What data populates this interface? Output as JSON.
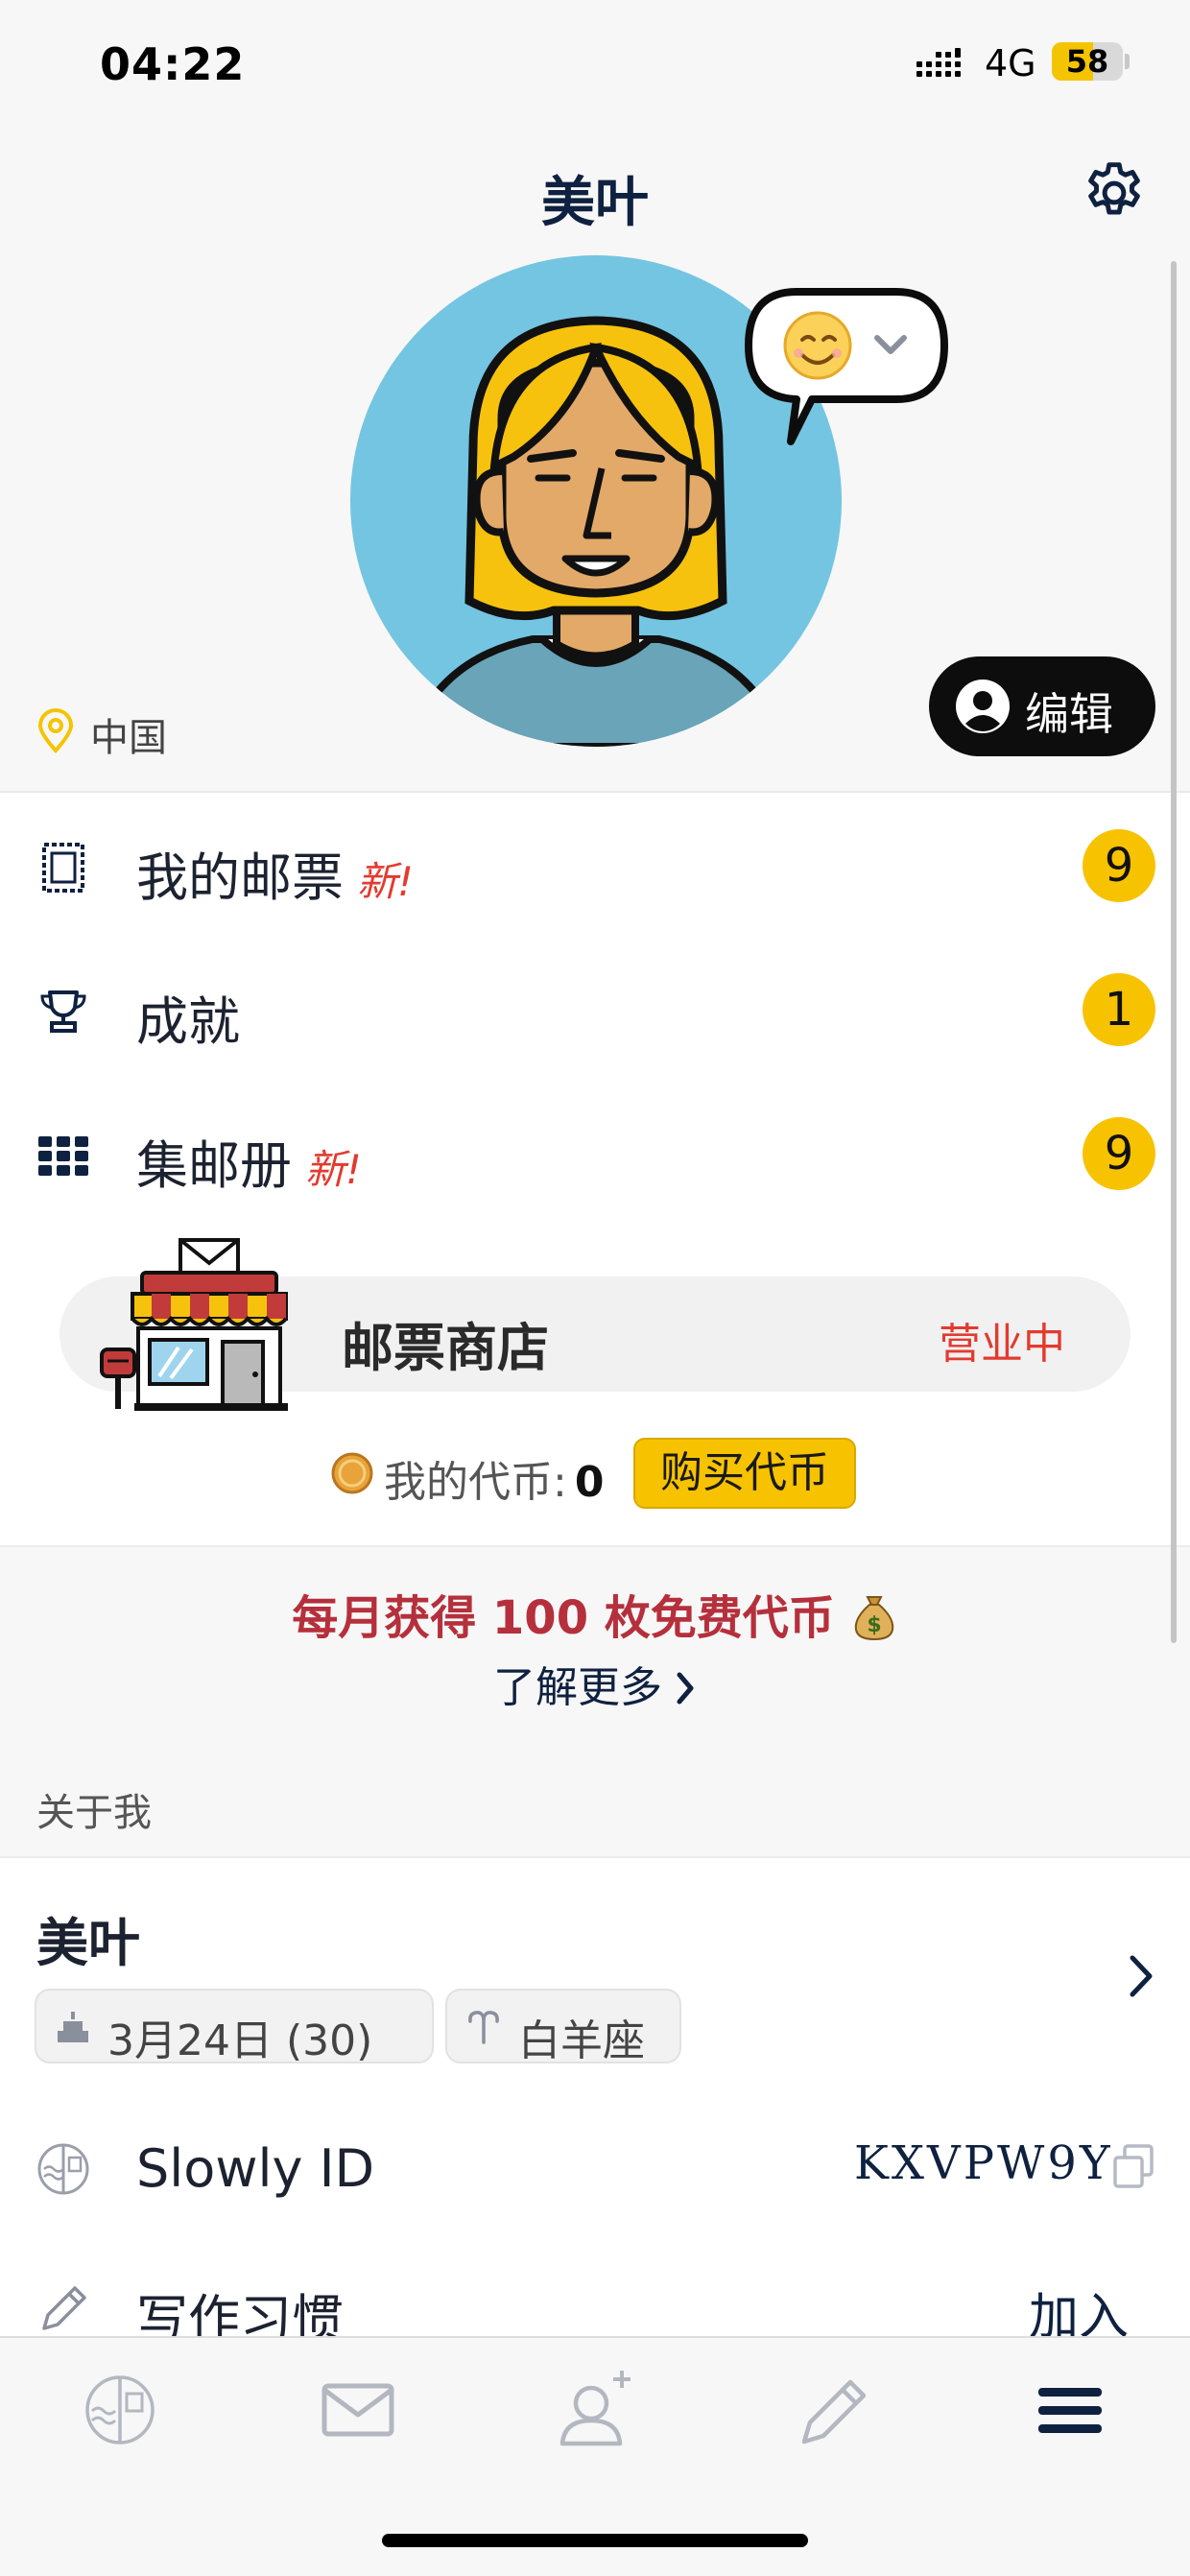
{
  "status_bar": {
    "time": "04:22",
    "network": "4G",
    "battery": "58",
    "battery_level_percent": 58,
    "battery_color": "#f5c400"
  },
  "header": {
    "title": "美叶",
    "settings_icon": "gear-icon"
  },
  "profile": {
    "mood_emoji": "😊",
    "location": "中国",
    "edit_label": "编辑"
  },
  "menu": [
    {
      "label": "我的邮票",
      "new": "新!",
      "count": "9",
      "icon": "stamp-icon"
    },
    {
      "label": "成就",
      "new": "",
      "count": "1",
      "icon": "trophy-icon"
    },
    {
      "label": "集邮册",
      "new": "新!",
      "count": "9",
      "icon": "grid-icon"
    }
  ],
  "store": {
    "title": "邮票商店",
    "status": "营业中",
    "coins_label": "我的代币:",
    "coins_value": "0",
    "buy_label": "购买代币"
  },
  "promo": {
    "text": "每月获得 100 枚免费代币",
    "learn_more": "了解更多"
  },
  "about": {
    "section_title": "关于我",
    "name": "美叶",
    "birthday": "3月24日 (30)",
    "zodiac": "白羊座",
    "slowly_id_label": "Slowly ID",
    "slowly_id_value": "KXVPW9Y",
    "writing_habit_label": "写作习惯",
    "writing_habit_action": "加入"
  },
  "tabs": [
    "home-tab",
    "letters-tab",
    "add-friend-tab",
    "write-tab",
    "menu-tab"
  ],
  "colors": {
    "accent_yellow": "#f7c200",
    "new_red": "#e23b2f",
    "navy": "#0f2140",
    "promo_red": "#b5303c",
    "avatar_bg": "#74c5e1"
  }
}
